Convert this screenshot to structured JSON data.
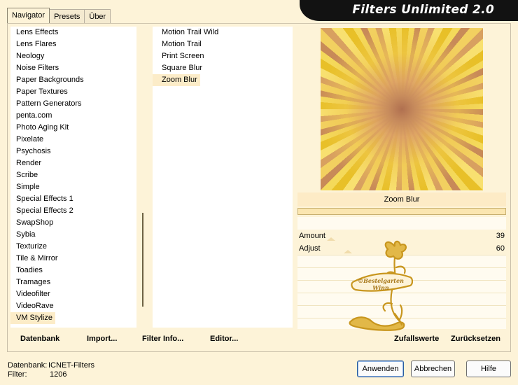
{
  "tabs": [
    "Navigator",
    "Presets",
    "Über"
  ],
  "active_tab": 0,
  "app_title": "Filters Unlimited 2.0",
  "categories": [
    "Lens Effects",
    "Lens Flares",
    "Neology",
    "Noise Filters",
    "Paper Backgrounds",
    "Paper Textures",
    "Pattern Generators",
    "penta.com",
    "Photo Aging Kit",
    "Pixelate",
    "Psychosis",
    "Render",
    "Scribe",
    "Simple",
    "Special Effects 1",
    "Special Effects 2",
    "SwapShop",
    "Sybia",
    "Texturize",
    "Tile & Mirror",
    "Toadies",
    "Tramages",
    "Videofilter",
    "VideoRave",
    "VM Stylize"
  ],
  "selected_category": "VM Stylize",
  "filters": [
    "Motion Trail Wild",
    "Motion Trail",
    "Print Screen",
    "Square Blur",
    "Zoom Blur"
  ],
  "selected_filter": "Zoom Blur",
  "preview_label": "Zoom Blur",
  "params": [
    {
      "label": "Amount",
      "value": "39",
      "level": 0.153
    },
    {
      "label": "Adjust",
      "value": "60",
      "level": 0.235
    }
  ],
  "logo_text": [
    "©Bestelgarten",
    "Winn"
  ],
  "toolbar": {
    "datenbank": "Datenbank",
    "import": "Import...",
    "filter_info": "Filter Info...",
    "editor": "Editor...",
    "random": "Zufallswerte",
    "reset": "Zurücksetzen"
  },
  "status": {
    "db_label": "Datenbank:",
    "db_value": "ICNET-Filters",
    "filter_label": "Filter:",
    "filter_value": "1206"
  },
  "buttons": {
    "apply": "Anwenden",
    "cancel": "Abbrechen",
    "help": "Hilfe"
  },
  "colors": {
    "background": "#fdf3d8",
    "selection": "#fcecc8",
    "banner": "#121212",
    "logo_gold": "#c8961e"
  }
}
